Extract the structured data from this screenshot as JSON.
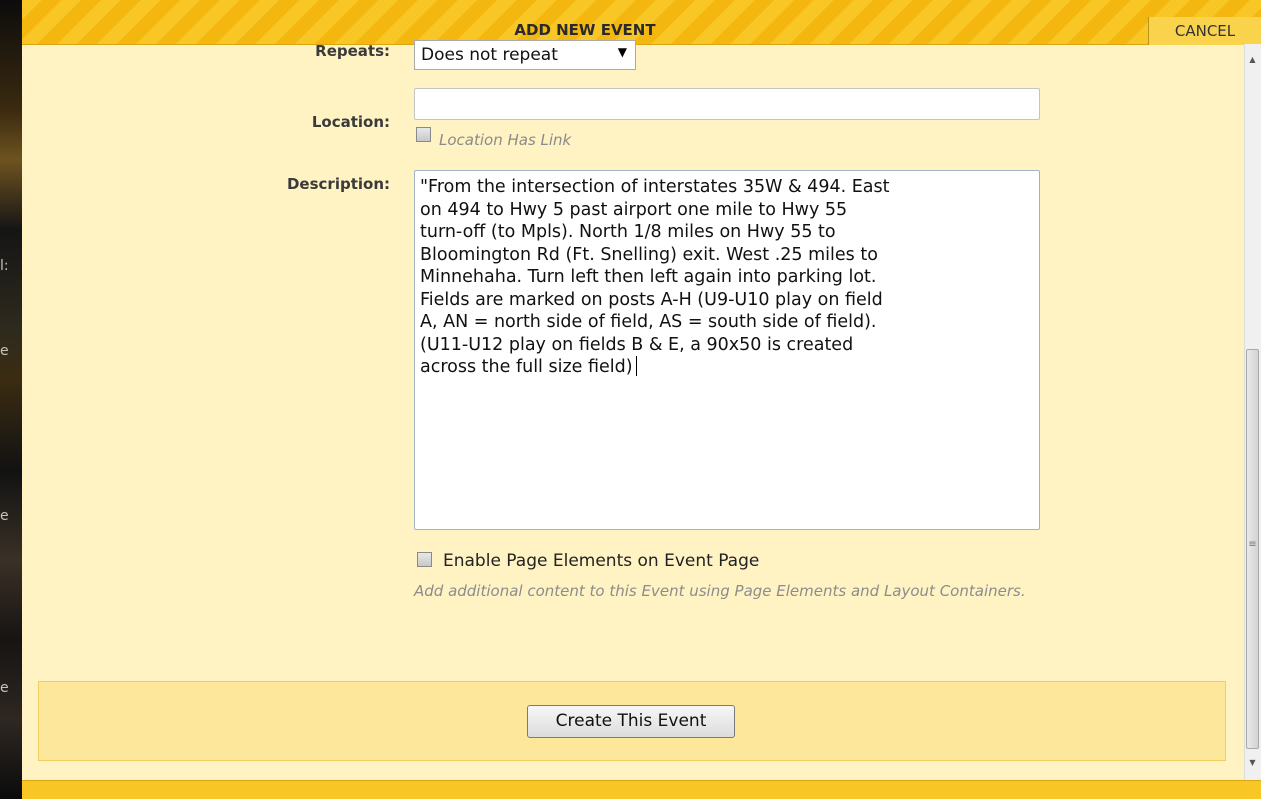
{
  "dialog": {
    "title": "ADD NEW EVENT",
    "cancel_label": "CANCEL"
  },
  "form": {
    "repeats_label": "Repeats:",
    "repeats_value": "Does not repeat",
    "location_label": "Location:",
    "location_value": "",
    "location_link_label": "Location Has Link",
    "description_label": "Description:",
    "description_value": "\"From the intersection of interstates 35W & 494. East\non 494 to Hwy 5 past airport one mile to Hwy 55\nturn-off (to Mpls). North 1/8 miles on Hwy 55 to\nBloomington Rd (Ft. Snelling) exit. West .25 miles to\nMinnehaha. Turn left then left again into parking lot.\nFields are marked on posts A-H (U9-U10 play on field\nA, AN = north side of field, AS = south side of field).\n(U11-U12 play on fields B & E, a 90x50 is created\nacross the full size field)",
    "enable_elements_label": "Enable Page Elements on Event Page",
    "enable_elements_help": "Add additional content to this Event using Page Elements and Layout Containers."
  },
  "actions": {
    "create_label": "Create This Event"
  },
  "icons": {
    "dropdown": "caret-down-icon",
    "scroll_up": "scroll-up-arrow-icon",
    "scroll_down": "scroll-down-arrow-icon",
    "grip": "scrollbar-grip-icon"
  },
  "colors": {
    "title_bar": "#f8c625",
    "dialog_bg": "#fff3c4",
    "footer_panel": "#fde79a"
  }
}
